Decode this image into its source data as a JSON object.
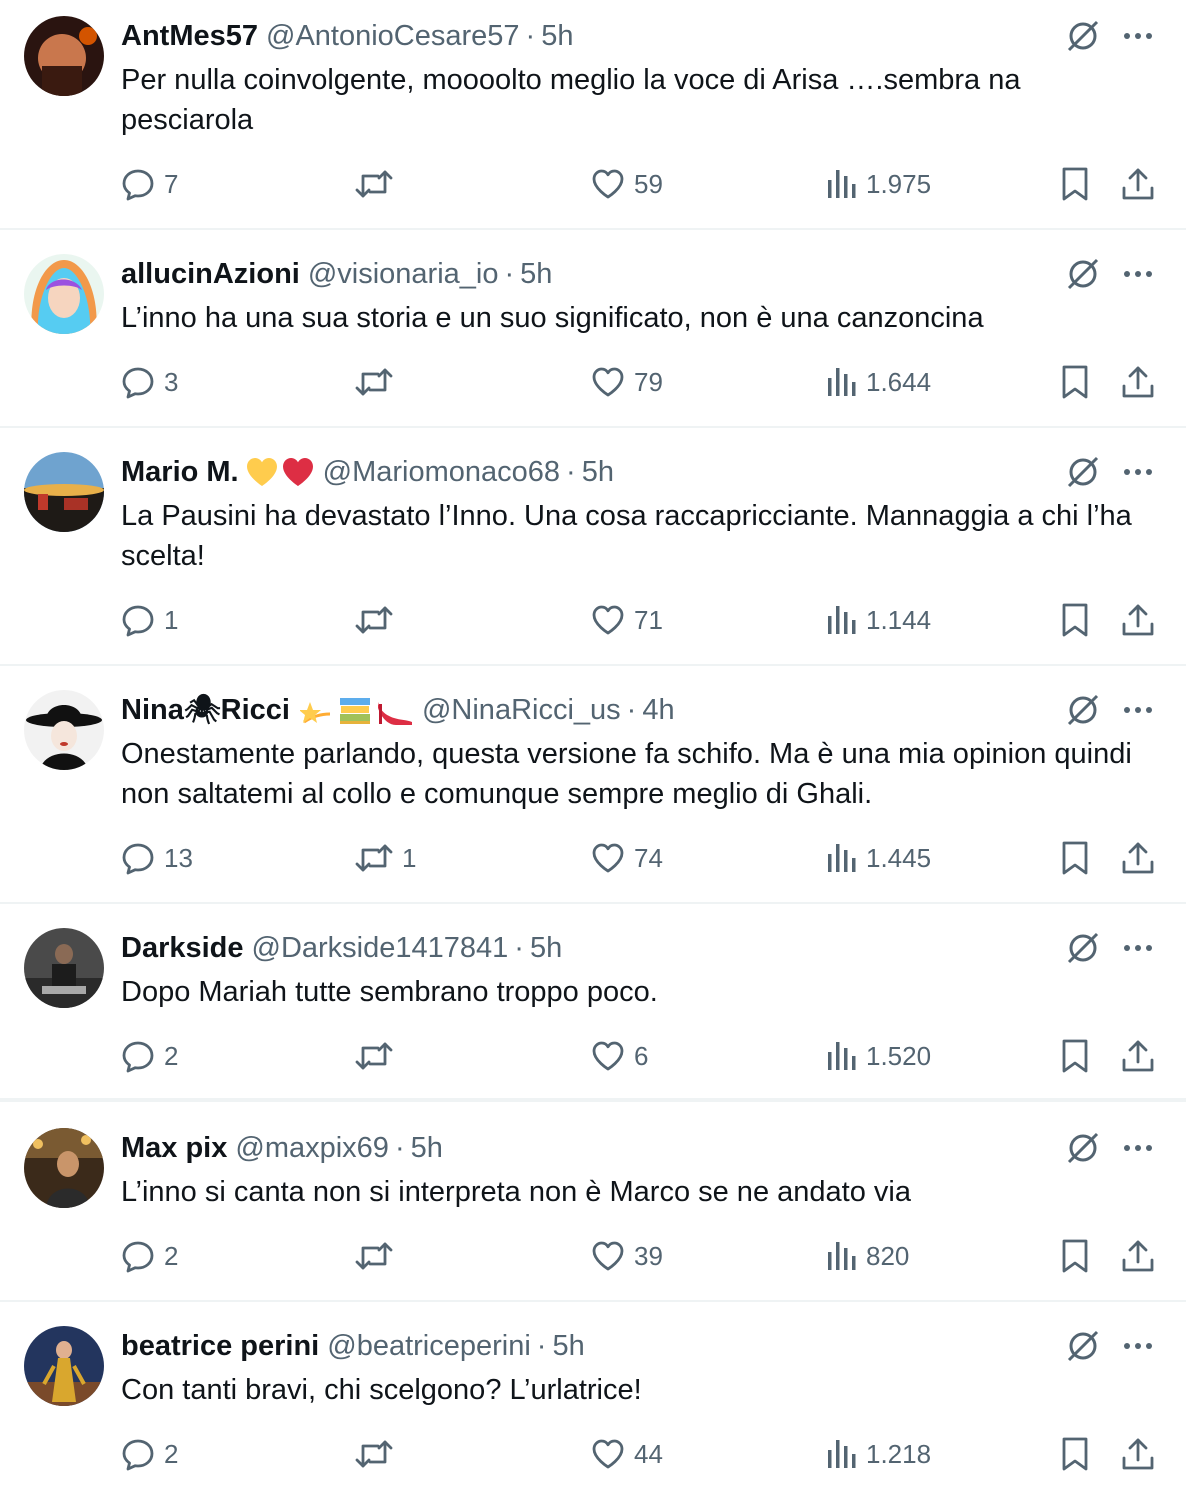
{
  "tweets": [
    {
      "name": "AntMes57",
      "emoji": [],
      "handle": "@AntonioCesare57",
      "separator": "·",
      "time": "5h",
      "text": "Per nulla coinvolgente, moooolto meglio la voce di Arisa ….sembra na pesciarola",
      "replies": "7",
      "retweets": "",
      "likes": "59",
      "views": "1.975",
      "avatar_colors": [
        "#3a1a10",
        "#c0392b"
      ]
    },
    {
      "name": "allucinAzioni",
      "emoji": [],
      "handle": "@visionaria_io",
      "separator": "·",
      "time": "5h",
      "text": "L’inno ha una sua storia e un suo significato, non è una canzoncina",
      "replies": "3",
      "retweets": "",
      "likes": "79",
      "views": "1.644",
      "avatar_colors": [
        "#f2c94c",
        "#6fcf97"
      ]
    },
    {
      "name": "Mario M.",
      "emoji": [
        "yellow-heart",
        "red-heart"
      ],
      "handle": "@Mariomonaco68",
      "separator": "·",
      "time": "5h",
      "text": "La Pausini ha devastato l’Inno. Una cosa raccapricciante. Mannaggia a chi l’ha scelta!",
      "replies": "1",
      "retweets": "",
      "likes": "71",
      "views": "1.144",
      "avatar_colors": [
        "#5a8fb8",
        "#c0392b"
      ]
    },
    {
      "name": "Nina🕷Ricci",
      "emoji": [
        "dizzy-star",
        "books",
        "high-heel"
      ],
      "handle": "@NinaRicci_us",
      "separator": "·",
      "time": "4h",
      "text": "Onestamente parlando, questa versione fa schifo. Ma è una mia opinion quindi non saltatemi al collo e comunque sempre meglio di Ghali.",
      "replies": "13",
      "retweets": "1",
      "likes": "74",
      "views": "1.445",
      "avatar_colors": [
        "#f0f0f0",
        "#111111"
      ]
    },
    {
      "name": "Darkside",
      "emoji": [],
      "handle": "@Darkside1417841",
      "separator": "·",
      "time": "5h",
      "text": "Dopo Mariah tutte sembrano troppo poco.",
      "replies": "2",
      "retweets": "",
      "likes": "6",
      "views": "1.520",
      "avatar_colors": [
        "#555555",
        "#2a2a2a"
      ]
    },
    {
      "name": "Max pix",
      "emoji": [],
      "handle": "@maxpix69",
      "separator": "·",
      "time": "5h",
      "text": "L’inno si canta non si interpreta non è Marco se ne andato via",
      "replies": "2",
      "retweets": "",
      "likes": "39",
      "views": "820",
      "avatar_colors": [
        "#6b4a2a",
        "#2b1d12"
      ]
    },
    {
      "name": "beatrice perini",
      "emoji": [],
      "handle": "@beatriceperini",
      "separator": "·",
      "time": "5h",
      "text": "Con tanti bravi, chi scelgono? L’urlatrice!",
      "replies": "2",
      "retweets": "",
      "likes": "44",
      "views": "1.218",
      "avatar_colors": [
        "#2d4f8a",
        "#d4a12a"
      ]
    }
  ],
  "colors": {
    "text": "#0f1419",
    "secondary": "#536471",
    "divider": "#eff3f4"
  }
}
